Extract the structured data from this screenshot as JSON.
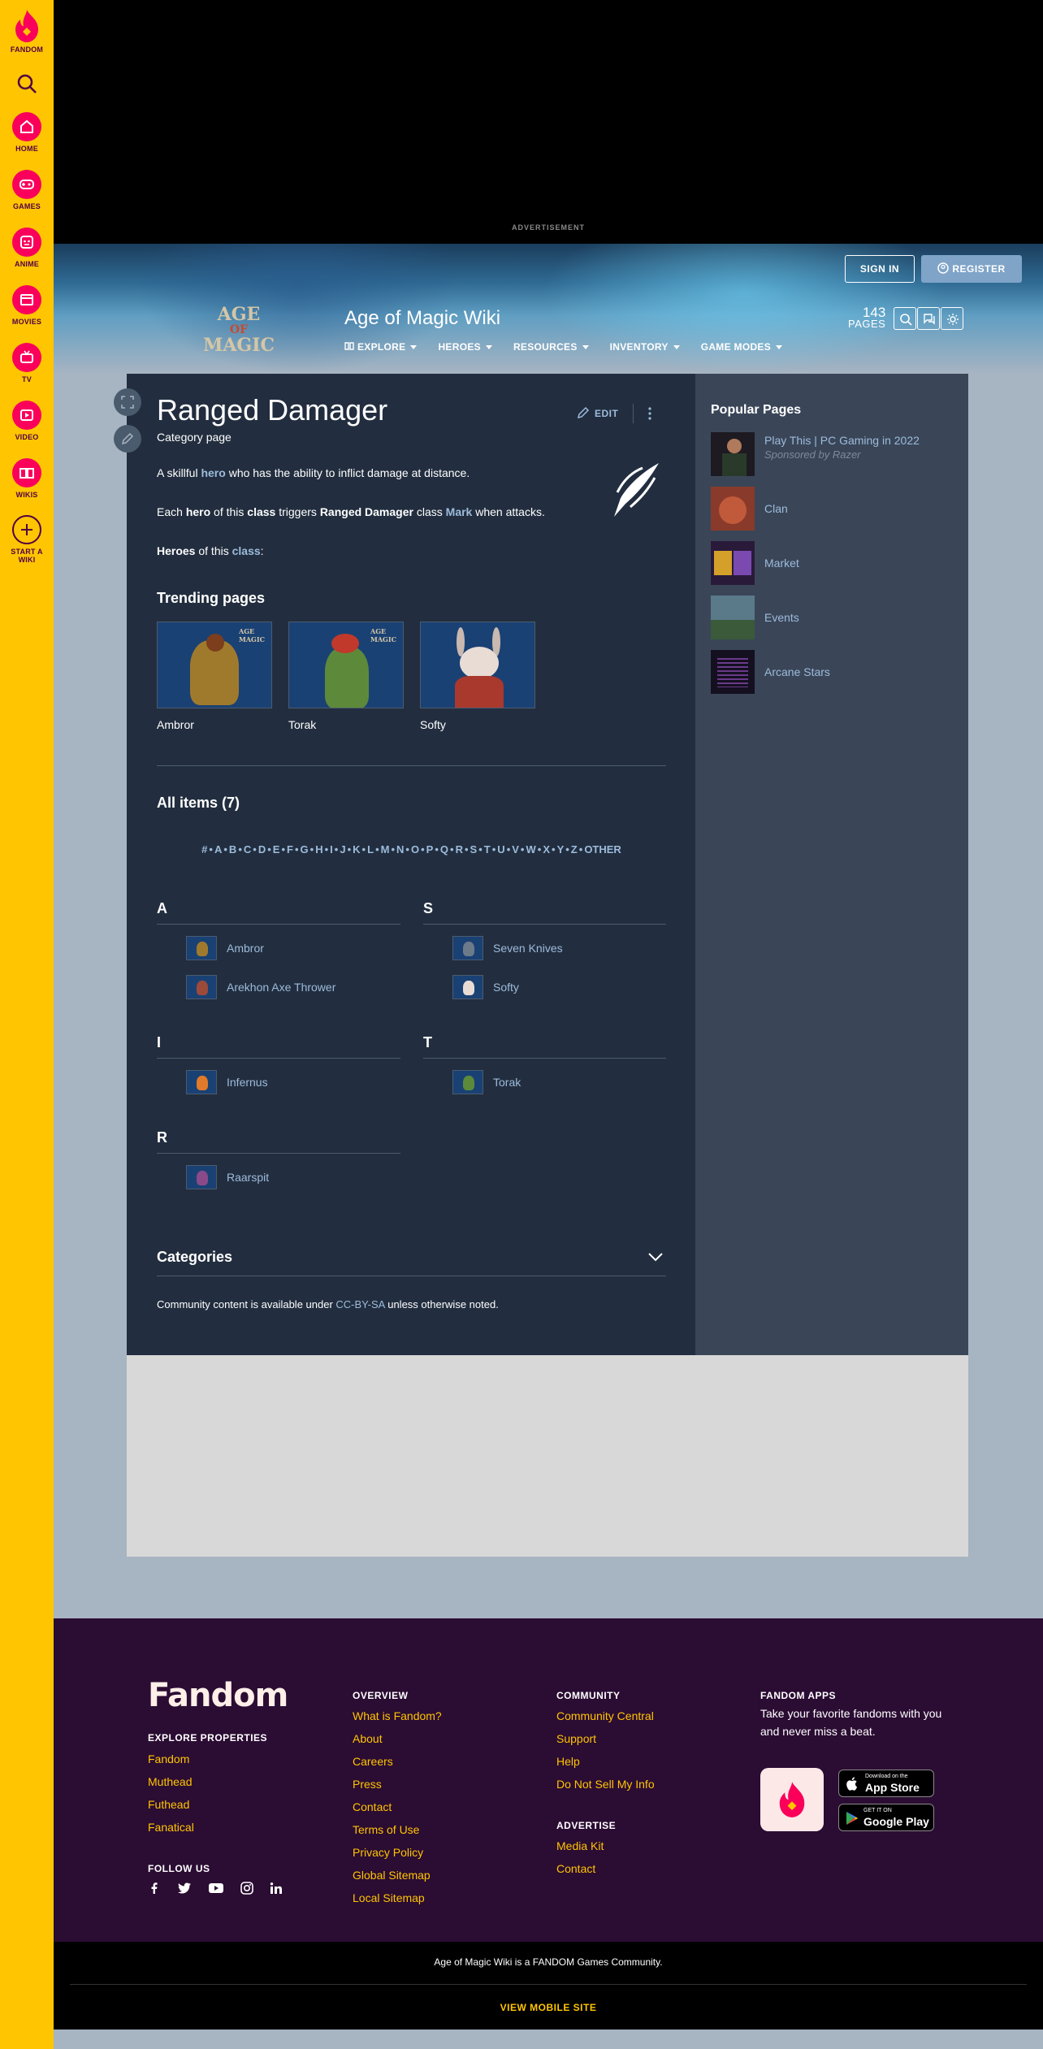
{
  "rail": [
    {
      "label": "FANDOM",
      "icon": "fandom-logo-icon"
    },
    {
      "label": "",
      "icon": "search-icon"
    },
    {
      "label": "HOME",
      "icon": "home-icon"
    },
    {
      "label": "GAMES",
      "icon": "games-icon"
    },
    {
      "label": "ANIME",
      "icon": "anime-icon"
    },
    {
      "label": "MOVIES",
      "icon": "movies-icon"
    },
    {
      "label": "TV",
      "icon": "tv-icon"
    },
    {
      "label": "VIDEO",
      "icon": "video-icon"
    },
    {
      "label": "WIKIS",
      "icon": "wikis-icon"
    },
    {
      "label": "START A",
      "label2": "WIKI",
      "icon": "plus-icon"
    }
  ],
  "ad": {
    "label": "ADVERTISEMENT"
  },
  "header": {
    "sign_in": "SIGN IN",
    "register": "REGISTER",
    "logo_line1": "AGE",
    "logo_line2": "OF",
    "logo_line3": "MAGIC",
    "wiki_title": "Age of Magic Wiki",
    "nav": [
      "EXPLORE",
      "HEROES",
      "RESOURCES",
      "INVENTORY",
      "GAME MODES"
    ],
    "pages_count": "143",
    "pages_label": "PAGES"
  },
  "article": {
    "title": "Ranged Damager",
    "subtitle": "Category page",
    "edit": "EDIT",
    "p1_a": "A skillful ",
    "p1_link": "hero",
    "p1_b": " who has the ability to inflict damage at distance.",
    "p2_a": "Each ",
    "p2_b1": "hero",
    "p2_c": " of this ",
    "p2_b2": "class",
    "p2_d": " triggers ",
    "p2_b3": "Ranged Damager",
    "p2_e": " class ",
    "p2_link": "Mark",
    "p2_f": " when attacks.",
    "p3_b": "Heroes",
    "p3_a": " of this ",
    "p3_link": "class",
    "p3_c": ":",
    "trending_heading": "Trending pages",
    "trending": [
      "Ambror",
      "Torak",
      "Softy"
    ],
    "all_items": "All items (7)",
    "alphabet": [
      "#",
      "A",
      "B",
      "C",
      "D",
      "E",
      "F",
      "G",
      "H",
      "I",
      "J",
      "K",
      "L",
      "M",
      "N",
      "O",
      "P",
      "Q",
      "R",
      "S",
      "T",
      "U",
      "V",
      "W",
      "X",
      "Y",
      "Z",
      "OTHER"
    ],
    "groups": {
      "A": {
        "letter": "A",
        "items": [
          "Ambror",
          "Arekhon Axe Thrower"
        ]
      },
      "S": {
        "letter": "S",
        "items": [
          "Seven Knives",
          "Softy"
        ]
      },
      "I": {
        "letter": "I",
        "items": [
          "Infernus"
        ]
      },
      "T": {
        "letter": "T",
        "items": [
          "Torak"
        ]
      },
      "R": {
        "letter": "R",
        "items": [
          "Raarspit"
        ]
      }
    },
    "categories": "Categories",
    "license_a": "Community content is available under ",
    "license_link": "CC-BY-SA",
    "license_b": " unless otherwise noted."
  },
  "popular": {
    "heading": "Popular Pages",
    "items": [
      {
        "title": "Play This | PC Gaming in 2022",
        "sponsor": "Sponsored by Razer"
      },
      {
        "title": "Clan"
      },
      {
        "title": "Market"
      },
      {
        "title": "Events"
      },
      {
        "title": "Arcane Stars"
      }
    ]
  },
  "footer": {
    "logo": "Fandom",
    "explore_h": "EXPLORE PROPERTIES",
    "explore": [
      "Fandom",
      "Muthead",
      "Futhead",
      "Fanatical"
    ],
    "follow_h": "FOLLOW US",
    "overview_h": "OVERVIEW",
    "overview": [
      "What is Fandom?",
      "About",
      "Careers",
      "Press",
      "Contact",
      "Terms of Use",
      "Privacy Policy",
      "Global Sitemap",
      "Local Sitemap"
    ],
    "community_h": "COMMUNITY",
    "community": [
      "Community Central",
      "Support",
      "Help",
      "Do Not Sell My Info"
    ],
    "advertise_h": "ADVERTISE",
    "advertise": [
      "Media Kit",
      "Contact"
    ],
    "apps_h": "FANDOM APPS",
    "apps_text": "Take your favorite fandoms with you and never miss a beat.",
    "appstore_small": "Download on the",
    "appstore": "App Store",
    "gplay_small": "GET IT ON",
    "gplay": "Google Play",
    "community_note": "Age of Magic Wiki is a FANDOM Games Community.",
    "mobile": "VIEW MOBILE SITE"
  },
  "colors": {
    "rail": "#ffc500",
    "accent": "#fa005a",
    "main": "#222e3f",
    "side": "#3a4658",
    "link": "#9dbbdb",
    "footer": "#2b0c33"
  }
}
